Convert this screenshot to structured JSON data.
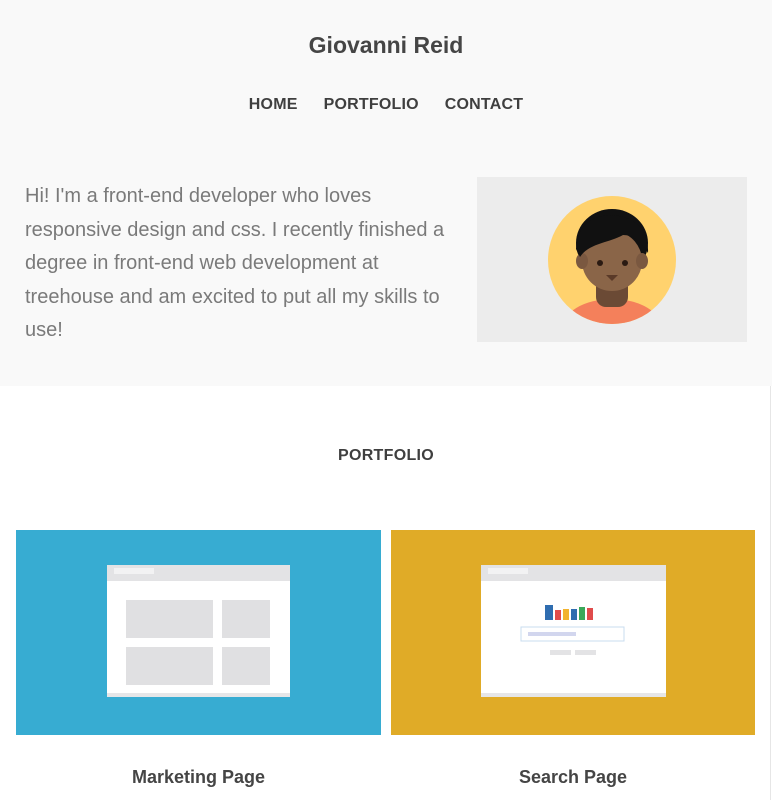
{
  "header": {
    "name": "Giovanni Reid",
    "nav": [
      {
        "label": "HOME"
      },
      {
        "label": "PORTFOLIO"
      },
      {
        "label": "CONTACT"
      }
    ]
  },
  "intro": {
    "text": "Hi! I'm a front-end developer who loves responsive design and css. I recently finished a degree in front-end web development at treehouse and am excited to put all my skills to use!"
  },
  "portfolio": {
    "title": "PORTFOLIO",
    "projects": [
      {
        "title": "Marketing Page",
        "bg_color": "#37acd2",
        "icon": "marketing-page-thumbnail"
      },
      {
        "title": "Search Page",
        "bg_color": "#e0ab27",
        "icon": "search-page-thumbnail"
      }
    ]
  },
  "colors": {
    "hero_bg": "#f9f9f9",
    "avatar_bg": "#ececec",
    "avatar_circle": "#ffd26e",
    "text_muted": "#7a7a7a"
  }
}
